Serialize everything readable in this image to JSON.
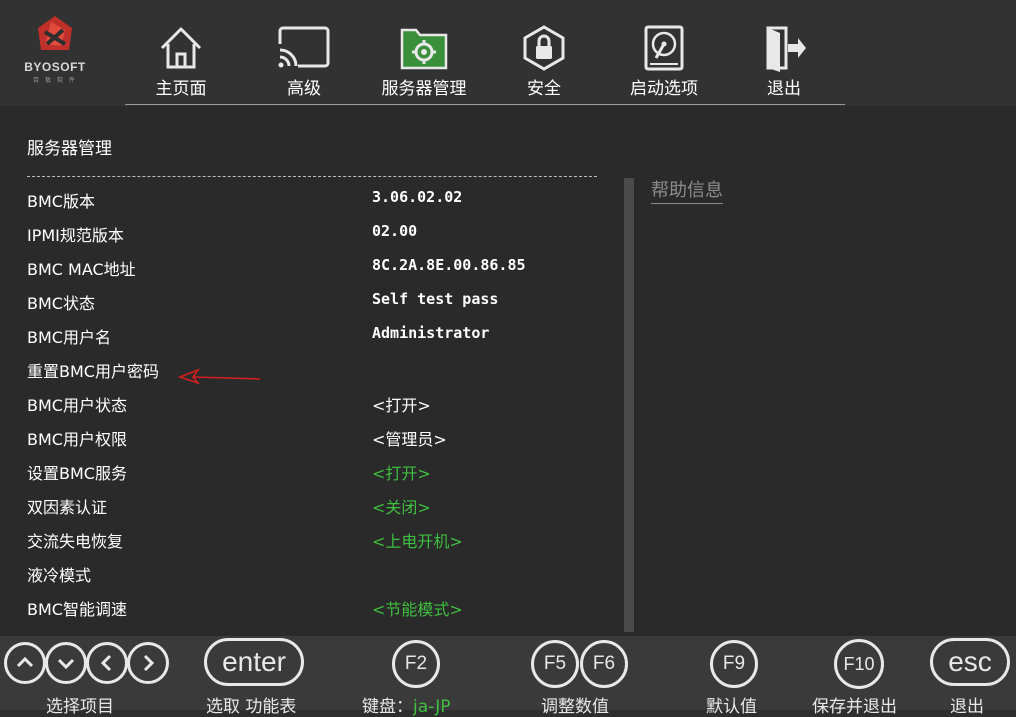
{
  "logo": {
    "text": "BYOSOFT",
    "sub": "百 敖 软 件"
  },
  "nav": {
    "tabs": [
      {
        "label": "主页面"
      },
      {
        "label": "高级"
      },
      {
        "label": "服务器管理"
      },
      {
        "label": "安全"
      },
      {
        "label": "启动选项"
      },
      {
        "label": "退出"
      }
    ]
  },
  "main": {
    "title": "服务器管理",
    "rows": [
      {
        "label": "BMC版本",
        "value": "3.06.02.02"
      },
      {
        "label": "IPMI规范版本",
        "value": "02.00"
      },
      {
        "label": "BMC MAC地址",
        "value": "8C.2A.8E.00.86.85"
      },
      {
        "label": "BMC状态",
        "value": "Self test pass"
      },
      {
        "label": "BMC用户名",
        "value": "Administrator"
      },
      {
        "label": "重置BMC用户密码",
        "value": ""
      },
      {
        "label": "BMC用户状态",
        "value": "<打开>"
      },
      {
        "label": "BMC用户权限",
        "value": "<管理员>"
      },
      {
        "label": "设置BMC服务",
        "value": "<打开>"
      },
      {
        "label": "双因素认证",
        "value": "<关闭>"
      },
      {
        "label": "交流失电恢复",
        "value": "<上电开机>"
      },
      {
        "label": "液冷模式",
        "value": ""
      },
      {
        "label": "BMC智能调速",
        "value": "<节能模式>"
      }
    ]
  },
  "help": {
    "title": "帮助信息"
  },
  "bottom": {
    "keys": {
      "enter": "enter",
      "f2": "F2",
      "f5": "F5",
      "f6": "F6",
      "f9": "F9",
      "f10": "F10",
      "esc": "esc"
    },
    "labels": {
      "select_item": "选择项目",
      "select_menu": "选取 功能表",
      "keyboard": "键盘：",
      "keyboard_value": "ja-JP",
      "adjust": "调整数值",
      "default": "默认值",
      "save_exit": "保存并退出",
      "exit": "退出"
    }
  },
  "colors": {
    "green": "#3fbf3f",
    "accent_tab": "#4caf50"
  }
}
